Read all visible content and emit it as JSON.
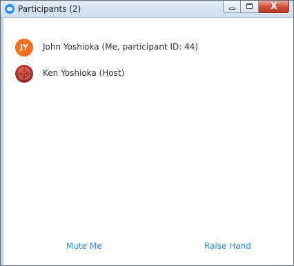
{
  "window": {
    "title": "Participants (2)",
    "close_glyph": "X"
  },
  "participants": [
    {
      "initials": "JY",
      "avatar_color": "#f36f21",
      "name": "John Yoshioka (Me, participant ID: 44)"
    },
    {
      "avatar_icon": "profile-photo-icon",
      "name": "Ken Yoshioka (Host)"
    }
  ],
  "footer": {
    "mute_label": "Mute Me",
    "raise_hand_label": "Raise Hand"
  },
  "colors": {
    "accent": "#2d8cff",
    "close_red": "#c13a2b"
  }
}
